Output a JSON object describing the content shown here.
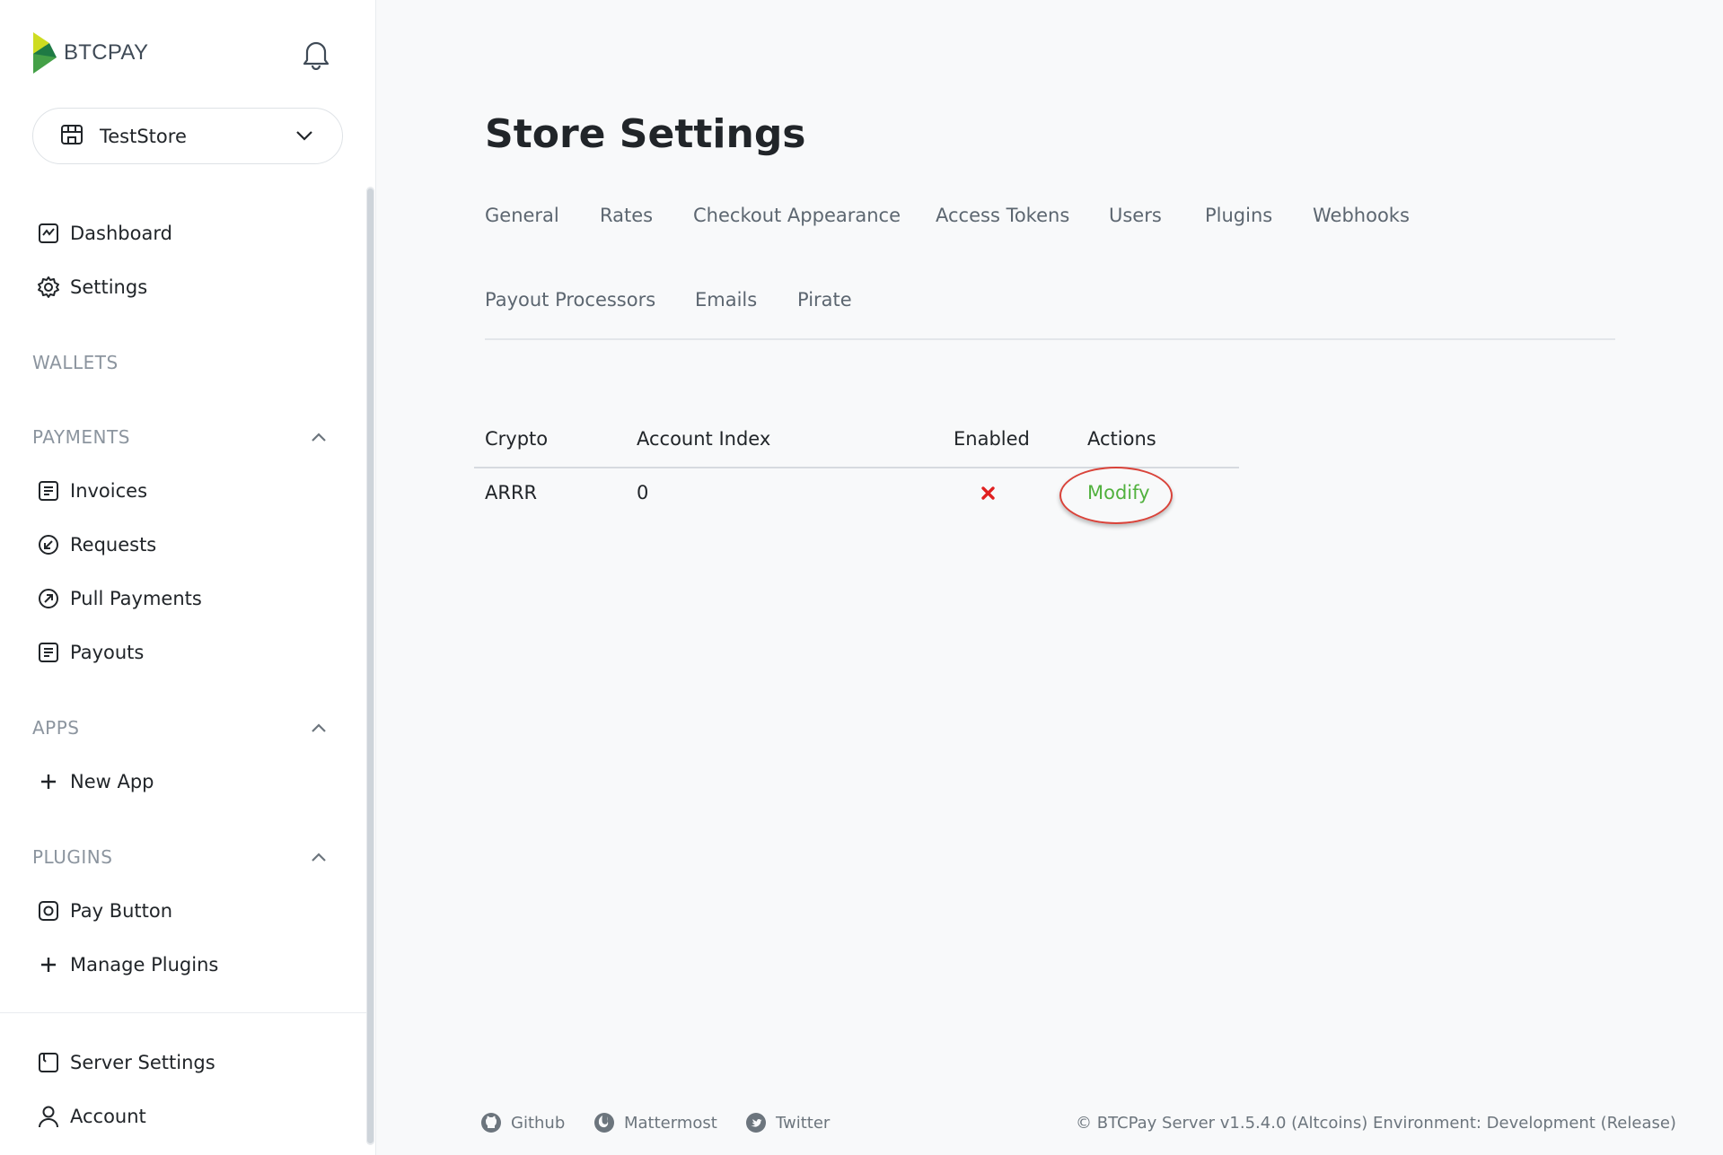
{
  "brand": {
    "name": "BTCPAY"
  },
  "store": {
    "name": "TestStore"
  },
  "nav": {
    "dashboard": "Dashboard",
    "settings": "Settings",
    "wallets_header": "WALLETS",
    "payments_header": "PAYMENTS",
    "invoices": "Invoices",
    "requests": "Requests",
    "pull_payments": "Pull Payments",
    "payouts": "Payouts",
    "apps_header": "APPS",
    "new_app": "New App",
    "plugins_header": "PLUGINS",
    "pay_button": "Pay Button",
    "manage_plugins": "Manage Plugins",
    "server_settings": "Server Settings",
    "account": "Account"
  },
  "page": {
    "title": "Store Settings",
    "tabs": [
      "General",
      "Rates",
      "Checkout Appearance",
      "Access Tokens",
      "Users",
      "Plugins",
      "Webhooks",
      "Payout Processors",
      "Emails",
      "Pirate"
    ]
  },
  "table": {
    "headers": [
      "Crypto",
      "Account Index",
      "Enabled",
      "Actions"
    ],
    "rows": [
      {
        "crypto": "ARRR",
        "account_index": "0",
        "enabled": false,
        "action": "Modify"
      }
    ]
  },
  "footer": {
    "links": [
      "Github",
      "Mattermost",
      "Twitter"
    ],
    "copyright": "© BTCPay Server v1.5.4.0 (Altcoins) Environment: Development (Release)"
  },
  "colors": {
    "accent": "#51b13e",
    "disabled_x": "#e02020",
    "highlight": "#d9433a",
    "logo_green": "#44a047",
    "logo_lime": "#cedc21"
  },
  "icons": {
    "dashboard": "dashboard-icon",
    "settings": "gear-icon",
    "invoices": "invoice-icon",
    "requests": "request-icon",
    "pull_payments": "pull-payment-icon",
    "payouts": "payout-icon",
    "new_app": "plus-icon",
    "pay_button": "pay-button-icon",
    "manage_plugins": "plus-icon",
    "server_settings": "server-icon",
    "account": "user-icon"
  }
}
